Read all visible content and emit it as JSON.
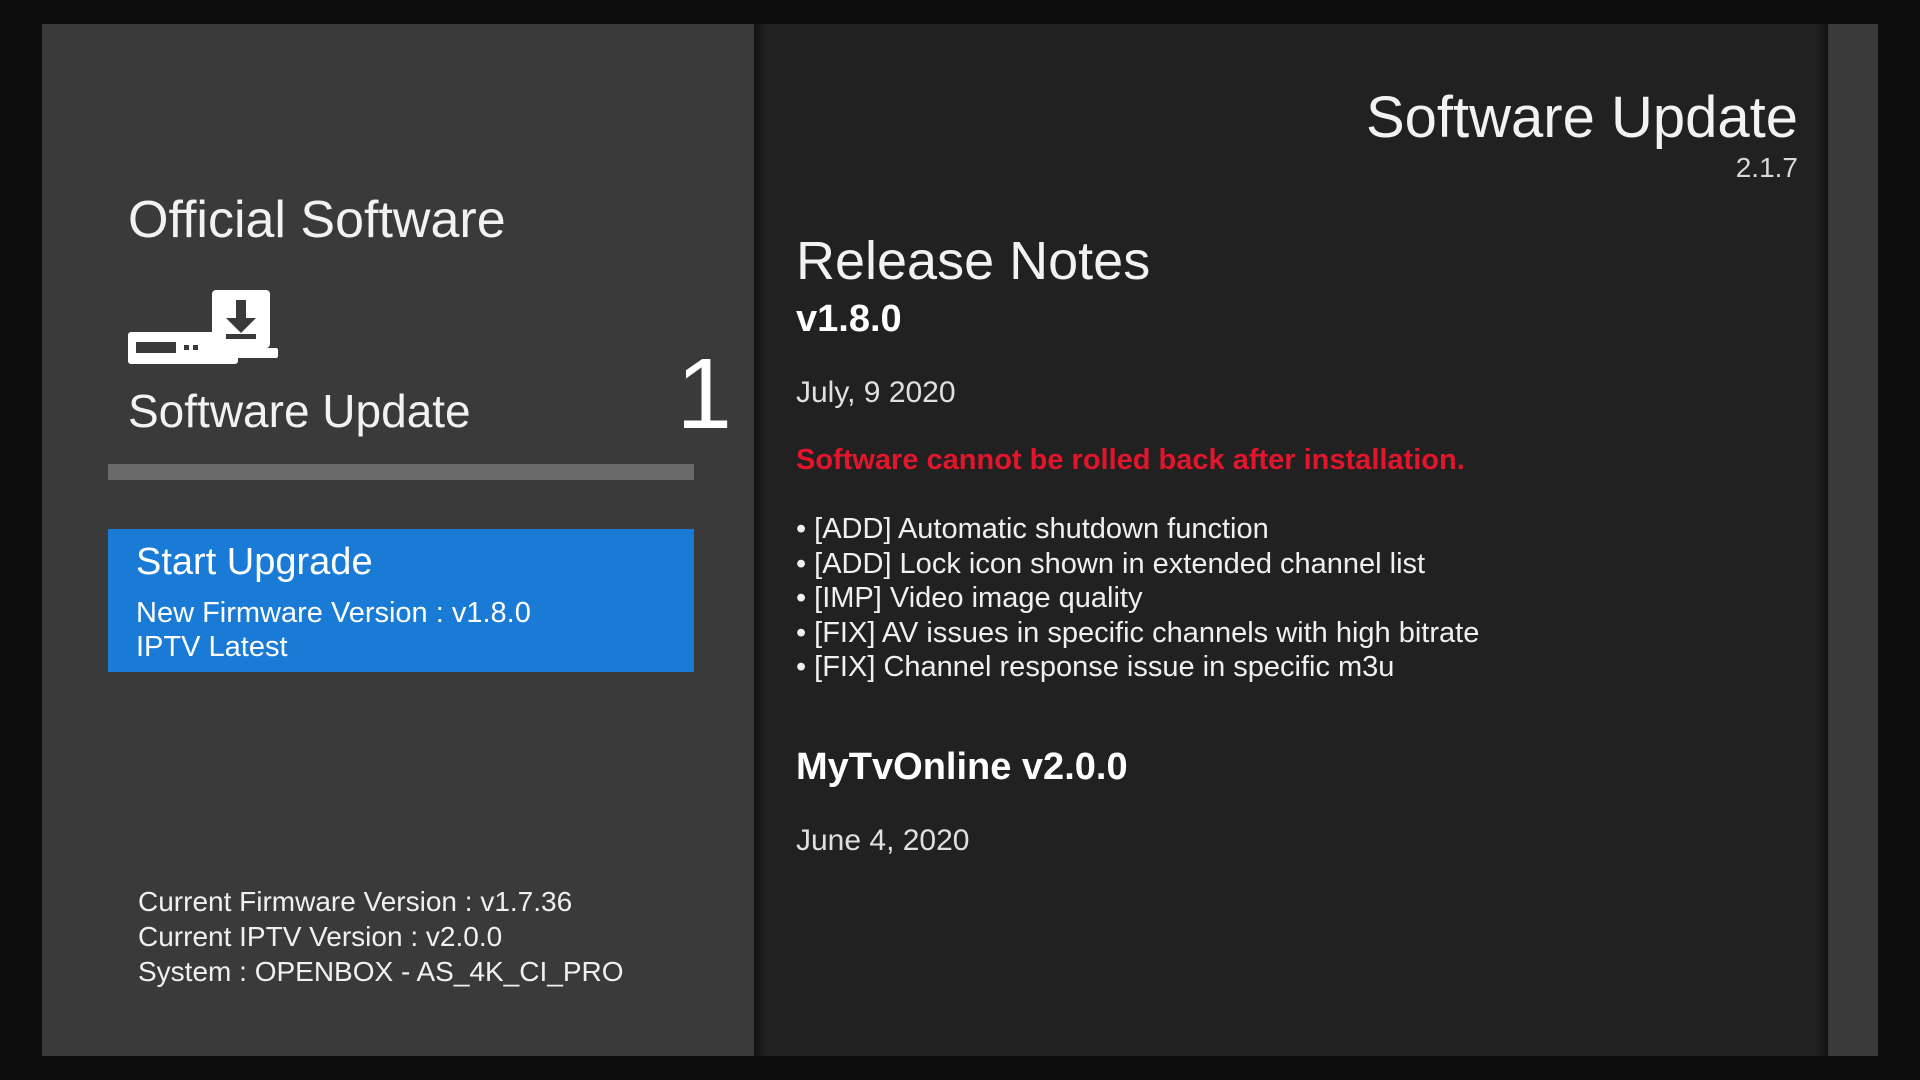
{
  "left_panel": {
    "title": "Official Software",
    "update_label": "Software Update",
    "update_count": "1",
    "progress_fraction": 1.0,
    "upgrade_card": {
      "title": "Start Upgrade",
      "firmware_line": "New Firmware Version : v1.8.0",
      "iptv_line": "IPTV Latest",
      "color": "#1a7bd6"
    },
    "system_info": {
      "firmware": "Current Firmware Version : v1.7.36",
      "iptv": "Current IPTV Version : v2.0.0",
      "system": "System : OPENBOX - AS_4K_CI_PRO"
    },
    "icons": [
      "set-top-box-download-icon"
    ]
  },
  "header": {
    "title": "Software Update",
    "version": "2.1.7"
  },
  "release_notes": {
    "title": "Release Notes",
    "version": "v1.8.0",
    "date": "July, 9 2020",
    "warning": "Software cannot be rolled back after installation.",
    "warning_color": "#e3152b",
    "bullet": "•",
    "items": [
      "[ADD] Automatic shutdown function",
      "[ADD] Lock icon shown in extended channel list",
      "[IMP] Video image quality",
      "[FIX] AV issues in specific channels with high bitrate",
      "[FIX] Channel response issue in specific m3u"
    ],
    "app_title": "MyTvOnline v2.0.0",
    "app_date": "June 4, 2020"
  }
}
